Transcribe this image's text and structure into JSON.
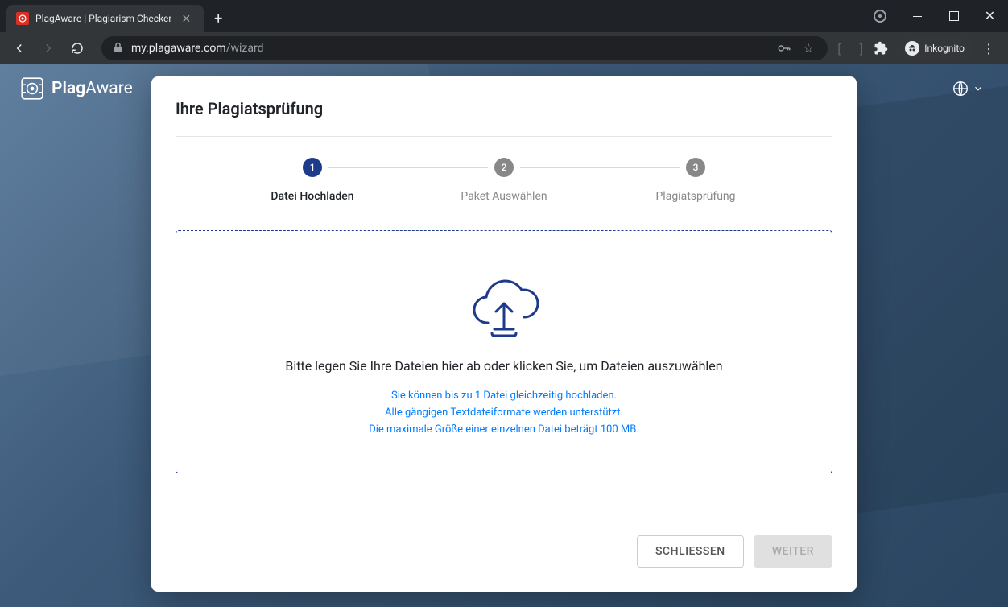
{
  "browser": {
    "tab_title": "PlagAware | Plagiarism Checker",
    "url_host": "my.plagaware.com",
    "url_path": "/wizard",
    "incognito_label": "Inkognito"
  },
  "app": {
    "brand_prefix": "Plag",
    "brand_suffix": "Aware"
  },
  "modal": {
    "title": "Ihre Plagiatsprüfung",
    "steps": [
      {
        "num": "1",
        "label": "Datei Hochladen"
      },
      {
        "num": "2",
        "label": "Paket Auswählen"
      },
      {
        "num": "3",
        "label": "Plagiatsprüfung"
      }
    ],
    "dropzone": {
      "main": "Bitte legen Sie Ihre Dateien hier ab oder klicken Sie, um Dateien auszuwählen",
      "sub1": "Sie können bis zu 1 Datei gleichzeitig hochladen.",
      "sub2": "Alle gängigen Textdateiformate werden unterstützt.",
      "sub3": "Die maximale Größe einer einzelnen Datei beträgt 100 MB."
    },
    "buttons": {
      "close": "SCHLIESSEN",
      "next": "WEITER"
    }
  }
}
